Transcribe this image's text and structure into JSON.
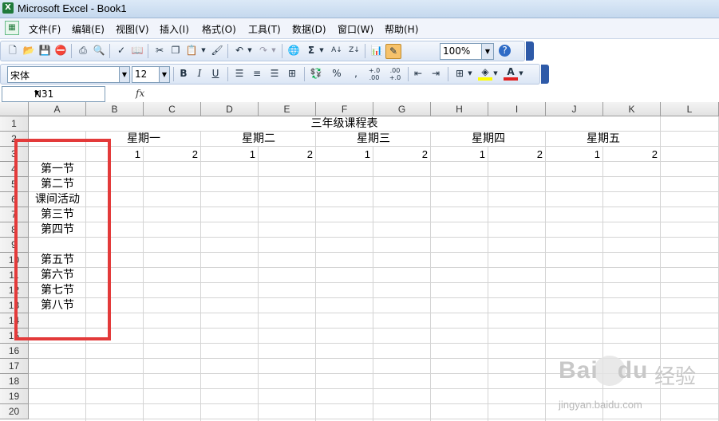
{
  "window": {
    "title": "Microsoft Excel - Book1",
    "app_icon": "excel-icon"
  },
  "menu": [
    "文件(F)",
    "编辑(E)",
    "视图(V)",
    "插入(I)",
    "格式(O)",
    "工具(T)",
    "数据(D)",
    "窗口(W)",
    "帮助(H)"
  ],
  "standard_toolbar": {
    "icons": [
      "new-icon",
      "open-icon",
      "save-icon",
      "permission-icon",
      "print-icon",
      "print-preview-icon",
      "spelling-icon",
      "research-icon",
      "cut-icon",
      "copy-icon",
      "paste-icon",
      "format-painter-icon",
      "undo-icon",
      "redo-icon",
      "hyperlink-icon",
      "autosum-icon",
      "sort-ascending-icon",
      "sort-descending-icon",
      "chart-wizard-icon",
      "drawing-icon",
      "help-icon"
    ],
    "zoom": "100%"
  },
  "formatting_toolbar": {
    "font_name": "宋体",
    "font_size": "12",
    "bold": "B",
    "italic": "I",
    "underline": "U",
    "percent": "%",
    "comma": ",",
    "increase_decimal": "+.0 .00",
    "decrease_decimal": ".00 +.0",
    "font_color_letter": "A",
    "font_color": "#e02020",
    "fill_color": "#ffff00"
  },
  "formula_bar": {
    "name_box": "N31",
    "fx": "fx",
    "content": ""
  },
  "sheet": {
    "columns": [
      "A",
      "B",
      "C",
      "D",
      "E",
      "F",
      "G",
      "H",
      "I",
      "J",
      "K",
      "L"
    ],
    "rows": [
      "1",
      "2",
      "3",
      "4",
      "5",
      "6",
      "7",
      "8",
      "9",
      "10",
      "11",
      "12",
      "13",
      "14",
      "15",
      "16",
      "17",
      "18",
      "19",
      "20"
    ],
    "title": "三年级课程表",
    "days": [
      "星期一",
      "星期二",
      "星期三",
      "星期四",
      "星期五"
    ],
    "sub_numbers": [
      "1",
      "2",
      "1",
      "2",
      "1",
      "2",
      "1",
      "2",
      "1",
      "2"
    ],
    "periods": [
      "第一节",
      "第二节",
      "课间活动",
      "第三节",
      "第四节",
      "",
      "第五节",
      "第六节",
      "第七节",
      "第八节"
    ]
  },
  "highlight_color": "#e33a3a",
  "watermark": {
    "brand": "Bai",
    "brand2": "du",
    "cn": "经验",
    "url": "jingyan.baidu.com"
  }
}
